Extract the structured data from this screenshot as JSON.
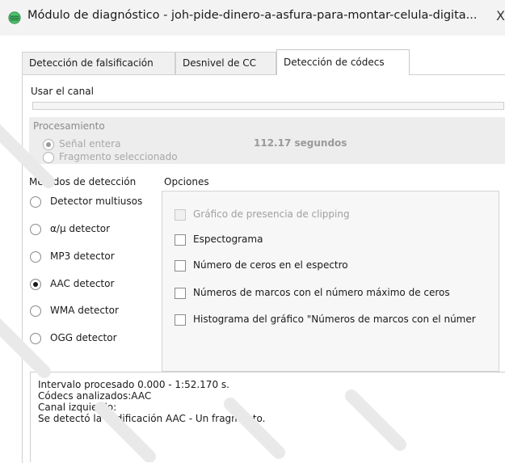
{
  "window": {
    "title": "Módulo de diagnóstico - joh-pide-dinero-a-asfura-para-montar-celula-digita...",
    "close_glyph": "X"
  },
  "tabs": [
    {
      "label": "Detección de falsificación",
      "active": false
    },
    {
      "label": "Desnivel de CC",
      "active": false
    },
    {
      "label": "Detección de códecs",
      "active": true
    }
  ],
  "channel": {
    "label": "Usar el canal"
  },
  "processing": {
    "title": "Procesamiento",
    "options": [
      {
        "label": "Señal entera",
        "selected": true
      },
      {
        "label": "Fragmento seleccionado",
        "selected": false
      }
    ],
    "duration": "112.17 segundos"
  },
  "methods": {
    "title": "Métodos de detección",
    "items": [
      {
        "label": "Detector multiusos",
        "selected": false
      },
      {
        "label": "α/μ detector",
        "selected": false
      },
      {
        "label": "MP3 detector",
        "selected": false
      },
      {
        "label": "AAC detector",
        "selected": true
      },
      {
        "label": "WMA detector",
        "selected": false
      },
      {
        "label": "OGG detector",
        "selected": false
      }
    ]
  },
  "options": {
    "title": "Opciones",
    "items": [
      {
        "label": "Gráfico de presencia de clipping",
        "checked": false,
        "enabled": false
      },
      {
        "label": "Espectograma",
        "checked": false,
        "enabled": true
      },
      {
        "label": "Número de ceros en el espectro",
        "checked": false,
        "enabled": true
      },
      {
        "label": "Números de marcos con el número máximo de ceros",
        "checked": false,
        "enabled": true
      },
      {
        "label": "Histograma del gráfico \"Números de marcos con el númer",
        "checked": false,
        "enabled": true
      }
    ]
  },
  "output": {
    "lines": [
      "Intervalo procesado 0.000 - 1:52.170 s.",
      "Códecs analizados:AAC",
      "Canal izquierdo:",
      "Se detectó la codificación AAC - Un fragmento."
    ]
  },
  "colors": {
    "accent_icon": "#3da35a",
    "panel_bg": "#ffffff",
    "group_bg": "#ededed"
  },
  "icons": {
    "app": "waveform-globe-icon",
    "radio": "radio-circle",
    "check": "checkbox-square"
  }
}
